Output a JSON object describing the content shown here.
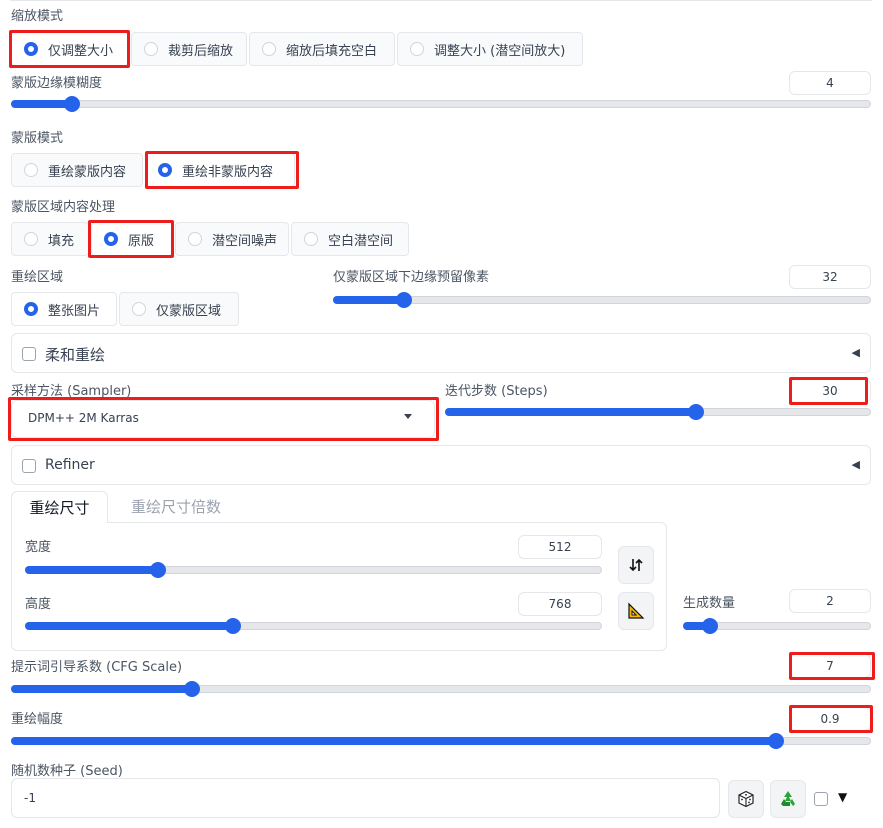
{
  "resize_mode": {
    "label": "缩放模式",
    "options": [
      "仅调整大小",
      "裁剪后缩放",
      "缩放后填充空白",
      "调整大小 (潜空间放大)"
    ],
    "selected": 0
  },
  "mask_blur": {
    "label": "蒙版边缘模糊度",
    "value": "4",
    "fraction": 0.07
  },
  "mask_mode": {
    "label": "蒙版模式",
    "options": [
      "重绘蒙版内容",
      "重绘非蒙版内容"
    ],
    "selected": 1
  },
  "masked_content": {
    "label": "蒙版区域内容处理",
    "options": [
      "填充",
      "原版",
      "潜空间噪声",
      "空白潜空间"
    ],
    "selected": 1
  },
  "inpaint_area": {
    "label": "重绘区域",
    "options": [
      "整张图片",
      "仅蒙版区域"
    ],
    "selected": 0
  },
  "padding": {
    "label": "仅蒙版区域下边缘预留像素",
    "value": "32",
    "fraction": 0.13
  },
  "soft_inpaint": {
    "label": "柔和重绘"
  },
  "sampler": {
    "label": "采样方法 (Sampler)",
    "value": "DPM++ 2M Karras"
  },
  "steps": {
    "label": "迭代步数 (Steps)",
    "value": "30",
    "fraction": 0.59
  },
  "refiner": {
    "label": "Refiner"
  },
  "size_tabs": {
    "tabs": [
      "重绘尺寸",
      "重绘尺寸倍数"
    ],
    "active": 0
  },
  "width": {
    "label": "宽度",
    "value": "512",
    "fraction": 0.23
  },
  "height": {
    "label": "高度",
    "value": "768",
    "fraction": 0.36
  },
  "batch_count": {
    "label": "生成数量",
    "value": "2",
    "fraction": 0.14
  },
  "cfg_scale": {
    "label": "提示词引导系数 (CFG Scale)",
    "value": "7",
    "fraction": 0.21
  },
  "denoising": {
    "label": "重绘幅度",
    "value": "0.9",
    "fraction": 0.89
  },
  "seed": {
    "label": "随机数种子 (Seed)",
    "value": "-1"
  },
  "icons": {
    "swap": "swap-arrows-icon",
    "ratio": "triangle-ruler-icon",
    "dice": "dice-icon",
    "recycle": "recycle-icon",
    "accent": "#2563eb",
    "highlight": "#ef1c1c"
  }
}
